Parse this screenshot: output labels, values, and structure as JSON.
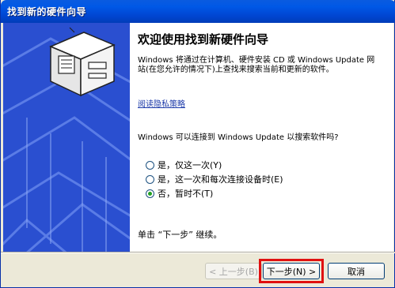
{
  "window": {
    "title": "找到新的硬件向导"
  },
  "content": {
    "heading": "欢迎使用找到新硬件向导",
    "description": "Windows 将通过在计算机、硬件安装 CD 或 Windows Update 网站(在您允许的情况下)上查找来搜索当前和更新的软件。",
    "privacy_link": "阅读隐私策略",
    "question": "Windows 可以连接到 Windows Update 以搜索软件吗?",
    "options": [
      {
        "label": "是，仅这一次(Y)",
        "checked": false
      },
      {
        "label": "是，这一次和每次连接设备时(E)",
        "checked": false
      },
      {
        "label": "否，暂时不(T)",
        "checked": true
      }
    ],
    "continue_text": "单击 “下一步” 继续。"
  },
  "buttons": {
    "back": "< 上一步(B)",
    "next": "下一步(N) >",
    "cancel": "取消"
  }
}
